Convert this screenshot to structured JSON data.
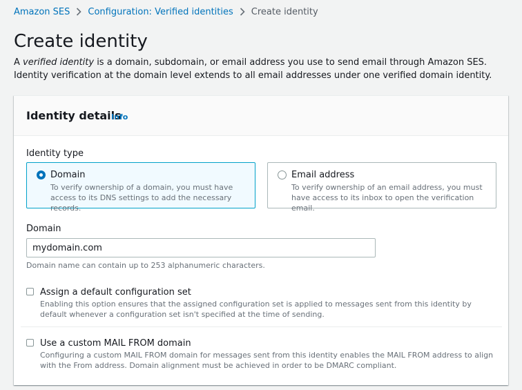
{
  "breadcrumb": {
    "items": [
      "Amazon SES",
      "Configuration: Verified identities"
    ],
    "current": "Create identity"
  },
  "page": {
    "title": "Create identity",
    "description_prefix": "A ",
    "description_emphasis": "verified identity",
    "description_rest": " is a domain, subdomain, or email address you use to send email through Amazon SES. Identity verification at the domain level extends to all email addresses under one verified domain identity."
  },
  "identity_details": {
    "title": "Identity details",
    "info_label": "Info",
    "identity_type_label": "Identity type",
    "options": [
      {
        "title": "Domain",
        "description": "To verify ownership of a domain, you must have access to its DNS settings to add the necessary records.",
        "selected": true
      },
      {
        "title": "Email address",
        "description": "To verify ownership of an email address, you must have access to its inbox to open the verification email.",
        "selected": false
      }
    ],
    "domain_label": "Domain",
    "domain_value": "mydomain.com",
    "domain_constraint": "Domain name can contain up to 253 alphanumeric characters.",
    "config_set": {
      "label": "Assign a default configuration set",
      "description": "Enabling this option ensures that the assigned configuration set is applied to messages sent from this identity by default whenever a configuration set isn't specified at the time of sending.",
      "checked": false
    },
    "mail_from": {
      "label": "Use a custom MAIL FROM domain",
      "description": "Configuring a custom MAIL FROM domain for messages sent from this identity enables the MAIL FROM address to align with the From address. Domain alignment must be achieved in order to be DMARC compliant.",
      "checked": false
    }
  },
  "colors": {
    "link": "#0073bb",
    "selected_border": "#00a1c9",
    "selected_bg": "#f1faff",
    "page_bg": "#f2f3f3"
  }
}
